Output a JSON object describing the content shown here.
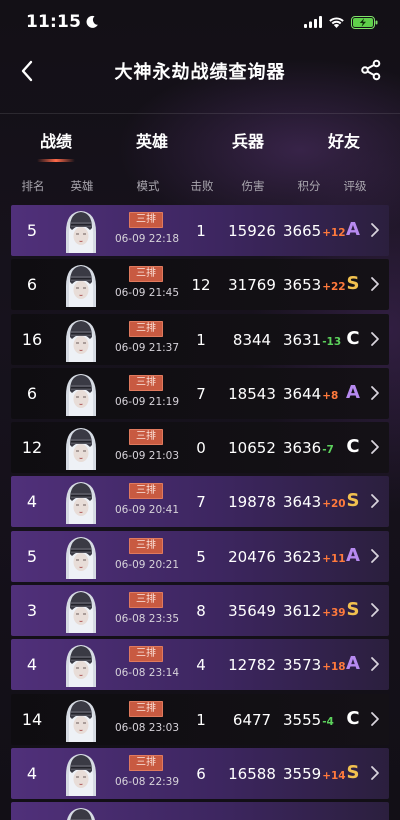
{
  "status_bar": {
    "time": "11:15",
    "icons": [
      "moon-icon",
      "signal-icon",
      "wifi-icon",
      "battery-charging-icon"
    ]
  },
  "nav": {
    "title": "大神永劫战绩查询器",
    "back_icon": "back-arrow-icon",
    "share_icon": "share-icon"
  },
  "tabs": [
    {
      "label": "战绩",
      "active": true
    },
    {
      "label": "英雄",
      "active": false
    },
    {
      "label": "兵器",
      "active": false
    },
    {
      "label": "好友",
      "active": false
    }
  ],
  "columns": {
    "rank": "排名",
    "hero": "英雄",
    "mode": "模式",
    "kills": "击败",
    "damage": "伤害",
    "score": "积分",
    "grade": "评级"
  },
  "colors": {
    "purple_row": "#50307a",
    "dark_row": "#0f0d11",
    "badge": "#c85a41",
    "delta_up": "#ff7a3c",
    "delta_down": "#5cd25c",
    "grade_A": "#b78af0",
    "grade_S": "#f2c14f",
    "grade_C": "#ffffff"
  },
  "matches": [
    {
      "rank": "5",
      "mode": "三排",
      "time": "06-09 22:18",
      "kills": "1",
      "damage": "15926",
      "score": "3665",
      "delta": "+12",
      "grade": "A",
      "highlight": true
    },
    {
      "rank": "6",
      "mode": "三排",
      "time": "06-09 21:45",
      "kills": "12",
      "damage": "31769",
      "score": "3653",
      "delta": "+22",
      "grade": "S",
      "highlight": false
    },
    {
      "rank": "16",
      "mode": "三排",
      "time": "06-09 21:37",
      "kills": "1",
      "damage": "8344",
      "score": "3631",
      "delta": "-13",
      "grade": "C",
      "highlight": false
    },
    {
      "rank": "6",
      "mode": "三排",
      "time": "06-09 21:19",
      "kills": "7",
      "damage": "18543",
      "score": "3644",
      "delta": "+8",
      "grade": "A",
      "highlight": false
    },
    {
      "rank": "12",
      "mode": "三排",
      "time": "06-09 21:03",
      "kills": "0",
      "damage": "10652",
      "score": "3636",
      "delta": "-7",
      "grade": "C",
      "highlight": false
    },
    {
      "rank": "4",
      "mode": "三排",
      "time": "06-09 20:41",
      "kills": "7",
      "damage": "19878",
      "score": "3643",
      "delta": "+20",
      "grade": "S",
      "highlight": true
    },
    {
      "rank": "5",
      "mode": "三排",
      "time": "06-09 20:21",
      "kills": "5",
      "damage": "20476",
      "score": "3623",
      "delta": "+11",
      "grade": "A",
      "highlight": true
    },
    {
      "rank": "3",
      "mode": "三排",
      "time": "06-08 23:35",
      "kills": "8",
      "damage": "35649",
      "score": "3612",
      "delta": "+39",
      "grade": "S",
      "highlight": true
    },
    {
      "rank": "4",
      "mode": "三排",
      "time": "06-08 23:14",
      "kills": "4",
      "damage": "12782",
      "score": "3573",
      "delta": "+18",
      "grade": "A",
      "highlight": true
    },
    {
      "rank": "14",
      "mode": "三排",
      "time": "06-08 23:03",
      "kills": "1",
      "damage": "6477",
      "score": "3555",
      "delta": "-4",
      "grade": "C",
      "highlight": false
    },
    {
      "rank": "4",
      "mode": "三排",
      "time": "06-08 22:39",
      "kills": "6",
      "damage": "16588",
      "score": "3559",
      "delta": "+14",
      "grade": "S",
      "highlight": true
    },
    {
      "rank": "",
      "mode": "",
      "time": "",
      "kills": "",
      "damage": "",
      "score": "",
      "delta": "",
      "grade": "",
      "highlight": true
    }
  ]
}
